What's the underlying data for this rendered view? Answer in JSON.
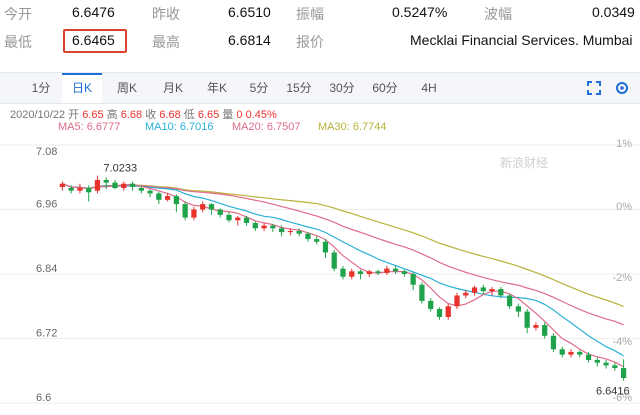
{
  "quote": {
    "open_label": "今开",
    "open_value": "6.6476",
    "prev_close_label": "昨收",
    "prev_close_value": "6.6510",
    "amplitude_label": "振幅",
    "amplitude_value": "0.5247%",
    "range_label": "波幅",
    "range_value": "0.0349",
    "low_label": "最低",
    "low_value": "6.6465",
    "high_label": "最高",
    "high_value": "6.6814",
    "quote_label": "报价",
    "quote_source": "Mecklai Financial Services. Mumbai"
  },
  "toolbar": {
    "tabs": [
      "1分",
      "日K",
      "周K",
      "月K",
      "年K",
      "5分",
      "15分",
      "30分",
      "60分",
      "4H"
    ],
    "active_tab": "日K",
    "icons": [
      "fullscreen-icon",
      "settings-icon"
    ]
  },
  "infobar": {
    "date": "2020/10/22",
    "open_label": "开",
    "open": "6.65",
    "high_label": "高",
    "high": "6.68",
    "close_label": "收",
    "close": "6.68",
    "low_label": "低",
    "low": "6.65",
    "change_label": "量",
    "change": "0",
    "change_pct": "0.45%"
  },
  "ma_legend": [
    {
      "label": "MA5: 6.6777",
      "color": "#e06c8a"
    },
    {
      "label": "MA10: 6.7016",
      "color": "#29b0d6"
    },
    {
      "label": "MA20: 6.7507",
      "color": "#e06c8a"
    },
    {
      "label": "MA30: 6.7744",
      "color": "#b8b23a"
    }
  ],
  "watermark": "新浪财经",
  "chart_data": {
    "type": "candlestick",
    "ylim": [
      6.6,
      7.08
    ],
    "y_ticks": [
      "7.08",
      "6.96",
      "6.84",
      "6.72",
      "6.6"
    ],
    "pct_ticks": [
      "1%",
      "0%",
      "-2%",
      "-4%",
      "-6%"
    ],
    "annotations": [
      {
        "text": "7.0233",
        "value": 7.0233,
        "index": 4
      },
      {
        "text": "6.6416",
        "value": 6.6416,
        "index": 64
      }
    ],
    "colors": {
      "up": "#e8322d",
      "down": "#1fa34a"
    },
    "candles": [
      [
        7.002,
        7.008,
        6.995,
        7.012,
        6.99
      ],
      [
        7.0,
        6.995,
        6.99,
        7.005,
        6.985
      ],
      [
        6.995,
        7.0,
        6.99,
        7.008,
        6.988
      ],
      [
        7.0,
        6.992,
        6.975,
        7.005,
        6.97
      ],
      [
        6.995,
        7.015,
        6.99,
        7.023,
        6.988
      ],
      [
        7.015,
        7.01,
        6.998,
        7.02,
        6.994
      ],
      [
        7.01,
        7.0,
        6.998,
        7.015,
        6.995
      ],
      [
        7.0,
        7.008,
        6.995,
        7.012,
        6.992
      ],
      [
        7.008,
        7.002,
        6.995,
        7.012,
        6.99
      ],
      [
        7.0,
        6.995,
        6.99,
        7.003,
        6.985
      ],
      [
        6.995,
        6.99,
        6.983,
        6.998,
        6.975
      ],
      [
        6.99,
        6.978,
        6.97,
        6.993,
        6.966
      ],
      [
        6.978,
        6.985,
        6.975,
        6.99,
        6.97
      ],
      [
        6.985,
        6.97,
        6.955,
        6.988,
        6.95
      ],
      [
        6.97,
        6.945,
        6.94,
        6.975,
        6.938
      ],
      [
        6.945,
        6.96,
        6.94,
        6.965,
        6.935
      ],
      [
        6.96,
        6.97,
        6.955,
        6.975,
        6.95
      ],
      [
        6.97,
        6.96,
        6.95,
        6.972,
        6.945
      ],
      [
        6.96,
        6.95,
        6.945,
        6.962,
        6.94
      ],
      [
        6.95,
        6.94,
        6.936,
        6.955,
        6.932
      ],
      [
        6.94,
        6.945,
        6.93,
        6.948,
        6.926
      ],
      [
        6.945,
        6.935,
        6.93,
        6.948,
        6.925
      ],
      [
        6.935,
        6.925,
        6.92,
        6.938,
        6.915
      ],
      [
        6.925,
        6.93,
        6.92,
        6.935,
        6.918
      ],
      [
        6.93,
        6.925,
        6.918,
        6.933,
        6.914
      ],
      [
        6.925,
        6.918,
        6.91,
        6.93,
        6.905
      ],
      [
        6.918,
        6.92,
        6.912,
        6.925,
        6.908
      ],
      [
        6.92,
        6.915,
        6.91,
        6.925,
        6.905
      ],
      [
        6.915,
        6.905,
        6.9,
        6.918,
        6.895
      ],
      [
        6.905,
        6.9,
        6.895,
        6.91,
        6.89
      ],
      [
        6.9,
        6.88,
        6.87,
        6.905,
        6.865
      ],
      [
        6.88,
        6.85,
        6.845,
        6.885,
        6.84
      ],
      [
        6.85,
        6.835,
        6.83,
        6.855,
        6.825
      ],
      [
        6.835,
        6.845,
        6.83,
        6.85,
        6.825
      ],
      [
        6.845,
        6.84,
        6.83,
        6.848,
        6.825
      ],
      [
        6.84,
        6.845,
        6.835,
        6.848,
        6.83
      ],
      [
        6.845,
        6.842,
        6.838,
        6.848,
        6.835
      ],
      [
        6.842,
        6.85,
        6.838,
        6.855,
        6.835
      ],
      [
        6.85,
        6.845,
        6.84,
        6.855,
        6.838
      ],
      [
        6.845,
        6.84,
        6.835,
        6.848,
        6.83
      ],
      [
        6.84,
        6.82,
        6.81,
        6.843,
        6.805
      ],
      [
        6.82,
        6.79,
        6.785,
        6.825,
        6.78
      ],
      [
        6.79,
        6.775,
        6.77,
        6.795,
        6.765
      ],
      [
        6.775,
        6.76,
        6.755,
        6.778,
        6.75
      ],
      [
        6.76,
        6.78,
        6.755,
        6.785,
        6.752
      ],
      [
        6.78,
        6.8,
        6.775,
        6.805,
        6.772
      ],
      [
        6.8,
        6.805,
        6.795,
        6.81,
        6.79
      ],
      [
        6.805,
        6.815,
        6.8,
        6.818,
        6.795
      ],
      [
        6.815,
        6.808,
        6.802,
        6.82,
        6.8
      ],
      [
        6.808,
        6.812,
        6.8,
        6.816,
        6.798
      ],
      [
        6.812,
        6.8,
        6.795,
        6.816,
        6.79
      ],
      [
        6.8,
        6.78,
        6.775,
        6.803,
        6.77
      ],
      [
        6.78,
        6.77,
        6.76,
        6.785,
        6.755
      ],
      [
        6.77,
        6.74,
        6.73,
        6.775,
        6.725
      ],
      [
        6.74,
        6.745,
        6.735,
        6.75,
        6.73
      ],
      [
        6.745,
        6.725,
        6.72,
        6.75,
        6.715
      ],
      [
        6.725,
        6.7,
        6.695,
        6.73,
        6.69
      ],
      [
        6.7,
        6.69,
        6.685,
        6.705,
        6.68
      ],
      [
        6.69,
        6.695,
        6.685,
        6.7,
        6.68
      ],
      [
        6.695,
        6.69,
        6.685,
        6.698,
        6.682
      ],
      [
        6.69,
        6.68,
        6.675,
        6.695,
        6.672
      ],
      [
        6.68,
        6.675,
        6.668,
        6.685,
        6.664
      ],
      [
        6.675,
        6.67,
        6.664,
        6.68,
        6.66
      ],
      [
        6.67,
        6.665,
        6.66,
        6.675,
        6.656
      ],
      [
        6.665,
        6.6465,
        6.6416,
        6.6814,
        6.6416
      ]
    ]
  }
}
